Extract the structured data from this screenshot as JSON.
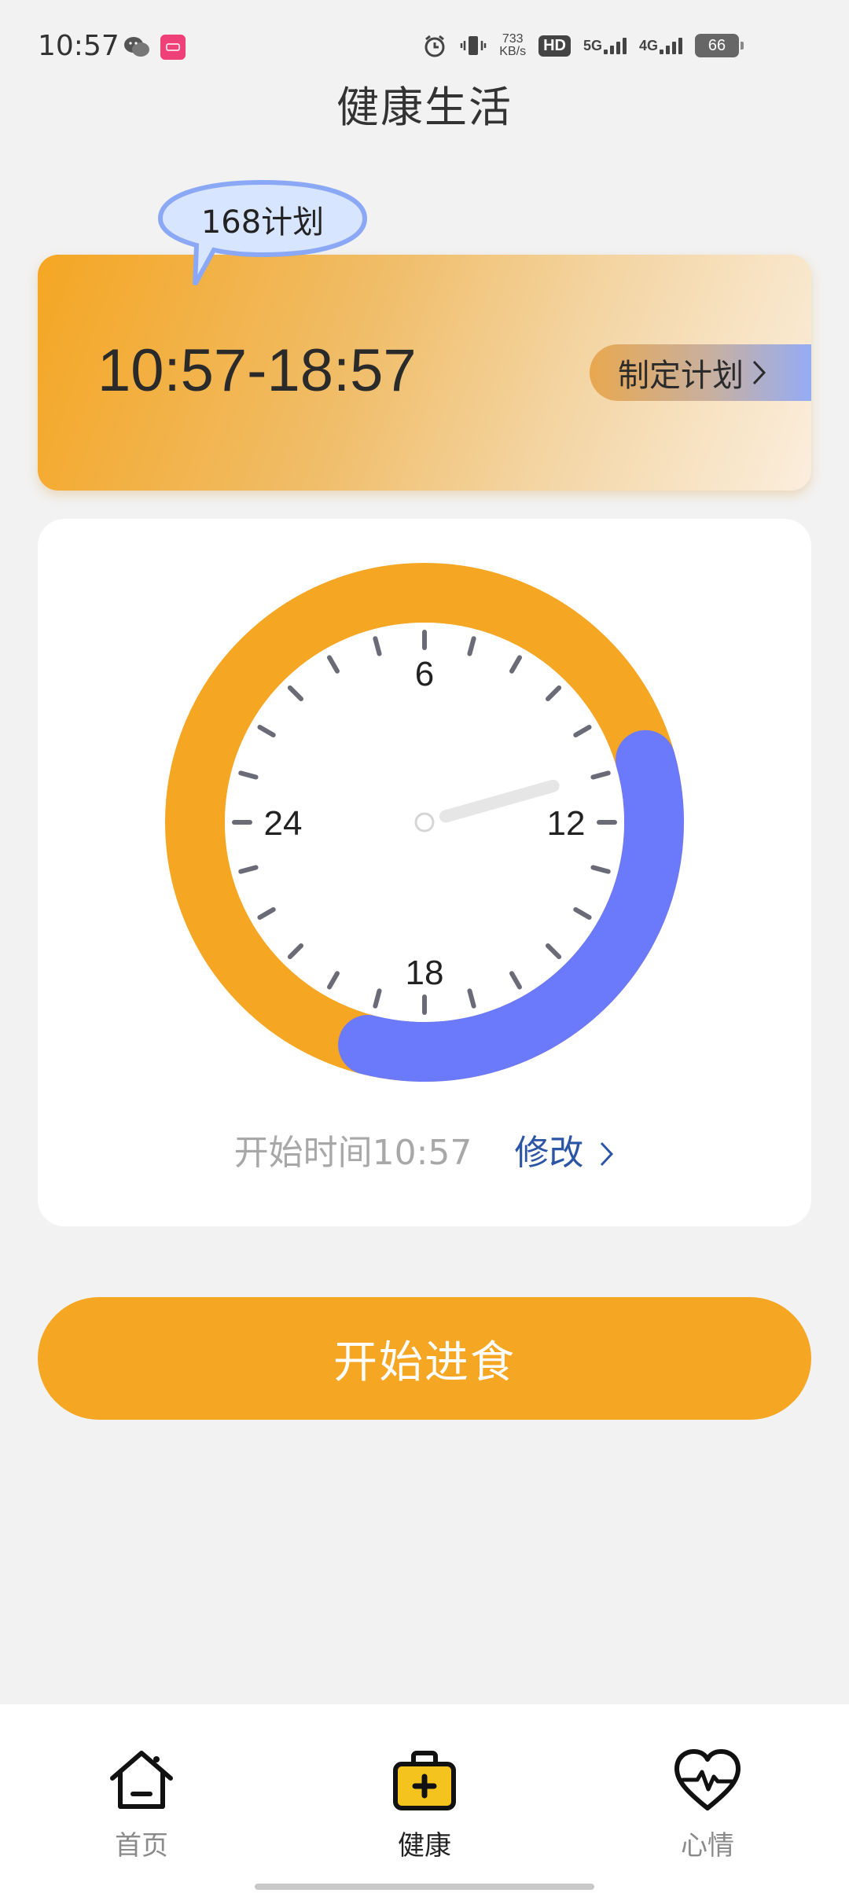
{
  "status_bar": {
    "time": "10:57",
    "net_speed_value": "733",
    "net_speed_unit": "KB/s",
    "hd_label": "HD",
    "sim1_label": "5G",
    "sim2_label": "4G",
    "battery": "66"
  },
  "header": {
    "title": "健康生活"
  },
  "plan_card": {
    "plan_name": "168计划",
    "time_range": "10:57-18:57",
    "make_plan_label": "制定计划",
    "chevron": "›"
  },
  "clock": {
    "labels": {
      "top": "6",
      "right": "12",
      "bottom": "18",
      "left": "24"
    },
    "fasting_color": "#f5a623",
    "eating_color": "#6b79fb",
    "hand_color": "#e6e6e6",
    "eating_start_hour": 10.95,
    "eating_end_hour": 18.95,
    "tick_count": 24
  },
  "start_time": {
    "label": "开始时间10:57",
    "edit_label": "修改",
    "chevron": "›"
  },
  "primary_button": {
    "label": "开始进食"
  },
  "bottom_nav": {
    "items": [
      {
        "label": "首页",
        "icon": "home-icon",
        "active": false
      },
      {
        "label": "健康",
        "icon": "medical-kit-icon",
        "active": true
      },
      {
        "label": "心情",
        "icon": "heart-pulse-icon",
        "active": false
      }
    ]
  },
  "colors": {
    "accent": "#f5a623",
    "link": "#2c55a6",
    "background": "#f2f2f2"
  }
}
